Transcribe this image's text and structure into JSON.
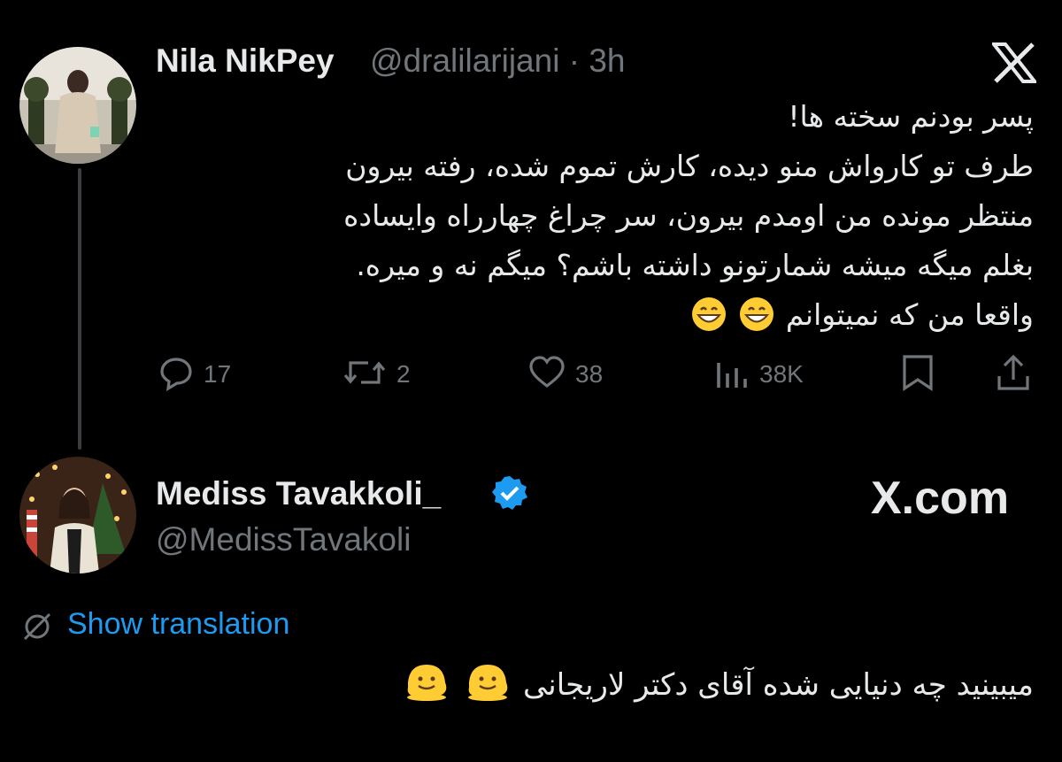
{
  "tweet1": {
    "name": "Nila NikPey",
    "handle": "@dralilarijani",
    "separator": "·",
    "time": "3h",
    "lines": [
      "پسر بودنم سخته ها!",
      "طرف تو کارواش منو دیده، کارش تموم شده، رفته بیرون",
      "منتظر مونده من اومدم بیرون، سر چراغ چهارراه وایساده",
      "بغلم میگه میشه شمارتونو داشته باشم؟ میگم نه و میره.",
      "واقعا من که نمیتوانم"
    ],
    "actions": {
      "replies": "17",
      "reposts": "2",
      "likes": "38",
      "views": "38K"
    }
  },
  "tweet2": {
    "name": "Mediss Tavakkoli_",
    "handle": "@MedissTavakoli",
    "watermark": "X.com",
    "show_translation": "Show translation",
    "text": "میبینید چه دنیایی شده آقای دکتر لاریجانی"
  },
  "colors": {
    "background": "#000000",
    "text": "#e7e9ea",
    "muted": "#71767b",
    "link": "#1d9bf0",
    "verified": "#1d9bf0"
  },
  "icons": [
    "x-logo-icon",
    "reply-icon",
    "repost-icon",
    "like-icon",
    "views-icon",
    "bookmark-icon",
    "share-icon",
    "verified-badge-icon",
    "globe-off-icon",
    "grinning-emoji",
    "melting-emoji"
  ]
}
